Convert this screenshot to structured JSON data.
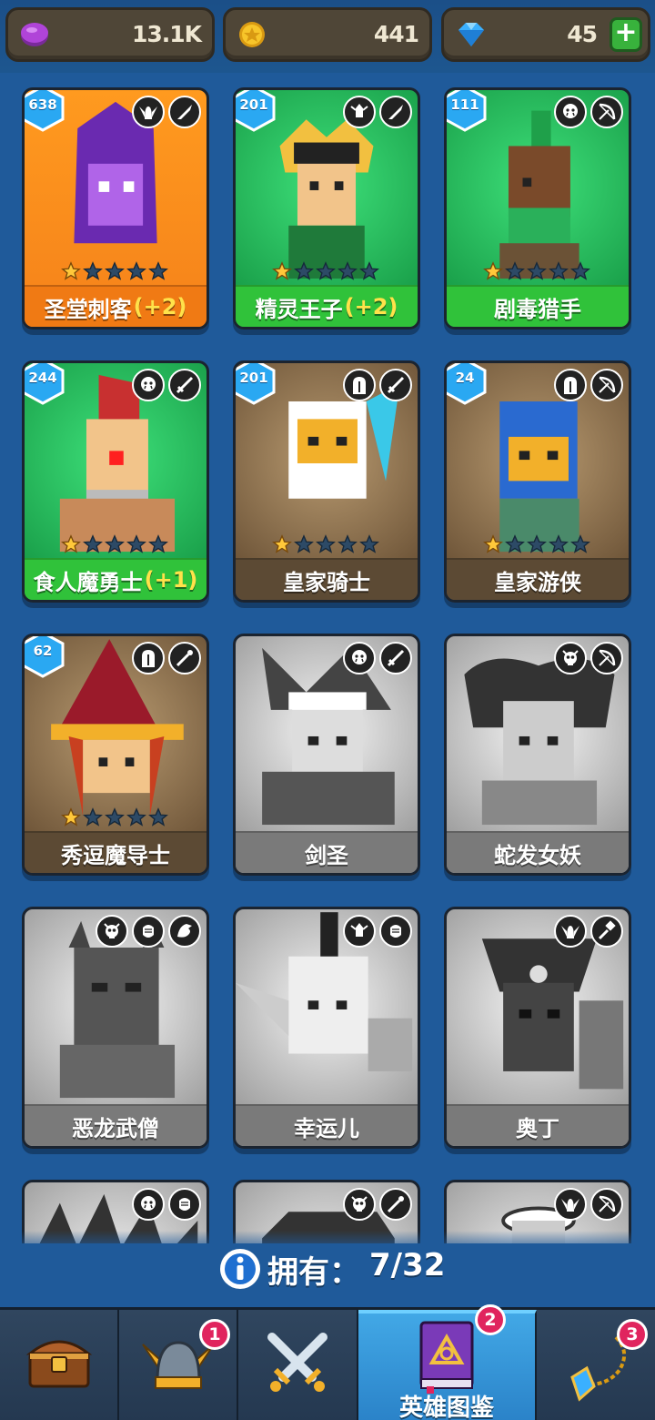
{
  "resources": [
    {
      "name": "purple-gem-icon",
      "value": "13.1K"
    },
    {
      "name": "gold-coin-icon",
      "value": "441"
    },
    {
      "name": "blue-diamond-icon",
      "value": "45",
      "plus": "+"
    }
  ],
  "heroes": [
    {
      "name": "圣堂刺客",
      "bonus": "(+2)",
      "level": "638",
      "stars": 1,
      "rarity": "orange",
      "icons": [
        "winged-helm-icon",
        "dagger-icon"
      ],
      "owned": true
    },
    {
      "name": "精灵王子",
      "bonus": "(+2)",
      "level": "201",
      "stars": 1,
      "rarity": "green",
      "icons": [
        "elf-icon",
        "dagger-icon"
      ],
      "owned": true
    },
    {
      "name": "剧毒猎手",
      "bonus": "",
      "level": "111",
      "stars": 1,
      "rarity": "green",
      "icons": [
        "orc-icon",
        "bow-icon"
      ],
      "owned": true
    },
    {
      "name": "食人魔勇士",
      "bonus": "(+1)",
      "level": "244",
      "stars": 1,
      "rarity": "green",
      "icons": [
        "orc-icon",
        "sword-icon"
      ],
      "owned": true
    },
    {
      "name": "皇家骑士",
      "bonus": "",
      "level": "201",
      "stars": 1,
      "rarity": "brown",
      "icons": [
        "knight-helm-icon",
        "sword-icon"
      ],
      "owned": true
    },
    {
      "name": "皇家游侠",
      "bonus": "",
      "level": "24",
      "stars": 1,
      "rarity": "brown",
      "icons": [
        "knight-helm-icon",
        "bow-icon"
      ],
      "owned": true
    },
    {
      "name": "秀逗魔导士",
      "bonus": "",
      "level": "62",
      "stars": 1,
      "rarity": "brown",
      "icons": [
        "knight-helm-icon",
        "wand-icon"
      ],
      "owned": true
    },
    {
      "name": "剑圣",
      "bonus": "",
      "level": "",
      "stars": 0,
      "rarity": "grey",
      "icons": [
        "orc-icon",
        "sword-icon"
      ],
      "owned": false
    },
    {
      "name": "蛇发女妖",
      "bonus": "",
      "level": "",
      "stars": 0,
      "rarity": "grey",
      "icons": [
        "skull-icon",
        "bow-icon"
      ],
      "owned": false
    },
    {
      "name": "恶龙武僧",
      "bonus": "",
      "level": "",
      "stars": 0,
      "rarity": "grey",
      "icons": [
        "skull-icon",
        "fist-icon",
        "dragon-icon"
      ],
      "owned": false
    },
    {
      "name": "幸运儿",
      "bonus": "",
      "level": "",
      "stars": 0,
      "rarity": "grey",
      "icons": [
        "elf-icon",
        "fist-icon"
      ],
      "owned": false
    },
    {
      "name": "奥丁",
      "bonus": "",
      "level": "",
      "stars": 0,
      "rarity": "grey",
      "icons": [
        "winged-helm-icon",
        "hammer-icon"
      ],
      "owned": false
    },
    {
      "name": "",
      "bonus": "",
      "level": "",
      "stars": 0,
      "rarity": "grey",
      "icons": [
        "orc-icon",
        "fist-icon"
      ],
      "owned": false
    },
    {
      "name": "",
      "bonus": "",
      "level": "",
      "stars": 0,
      "rarity": "grey",
      "icons": [
        "skull-icon",
        "wand-icon"
      ],
      "owned": false
    },
    {
      "name": "",
      "bonus": "",
      "level": "",
      "stars": 0,
      "rarity": "grey",
      "icons": [
        "winged-helm-icon",
        "bow-icon"
      ],
      "owned": false
    }
  ],
  "owned": {
    "label": "拥有：",
    "value": "7/32"
  },
  "nav": [
    {
      "name": "chest-icon",
      "label": "",
      "badge": "",
      "active": false
    },
    {
      "name": "viking-helmet-icon",
      "label": "",
      "badge": "1",
      "active": false
    },
    {
      "name": "crossed-swords-icon",
      "label": "",
      "badge": "",
      "active": false
    },
    {
      "name": "hero-book-icon",
      "label": "英雄图鉴",
      "badge": "2",
      "active": true
    },
    {
      "name": "amulet-icon",
      "label": "",
      "badge": "3",
      "active": false
    }
  ],
  "colors": {
    "background": "#1f5a9a",
    "card_orange": "#f5821a",
    "card_green": "#1aa04a",
    "card_brown": "#6b5236",
    "card_grey": "#9a9a9a",
    "badge": "#e0245e",
    "nav_active": "#2a82c8"
  }
}
